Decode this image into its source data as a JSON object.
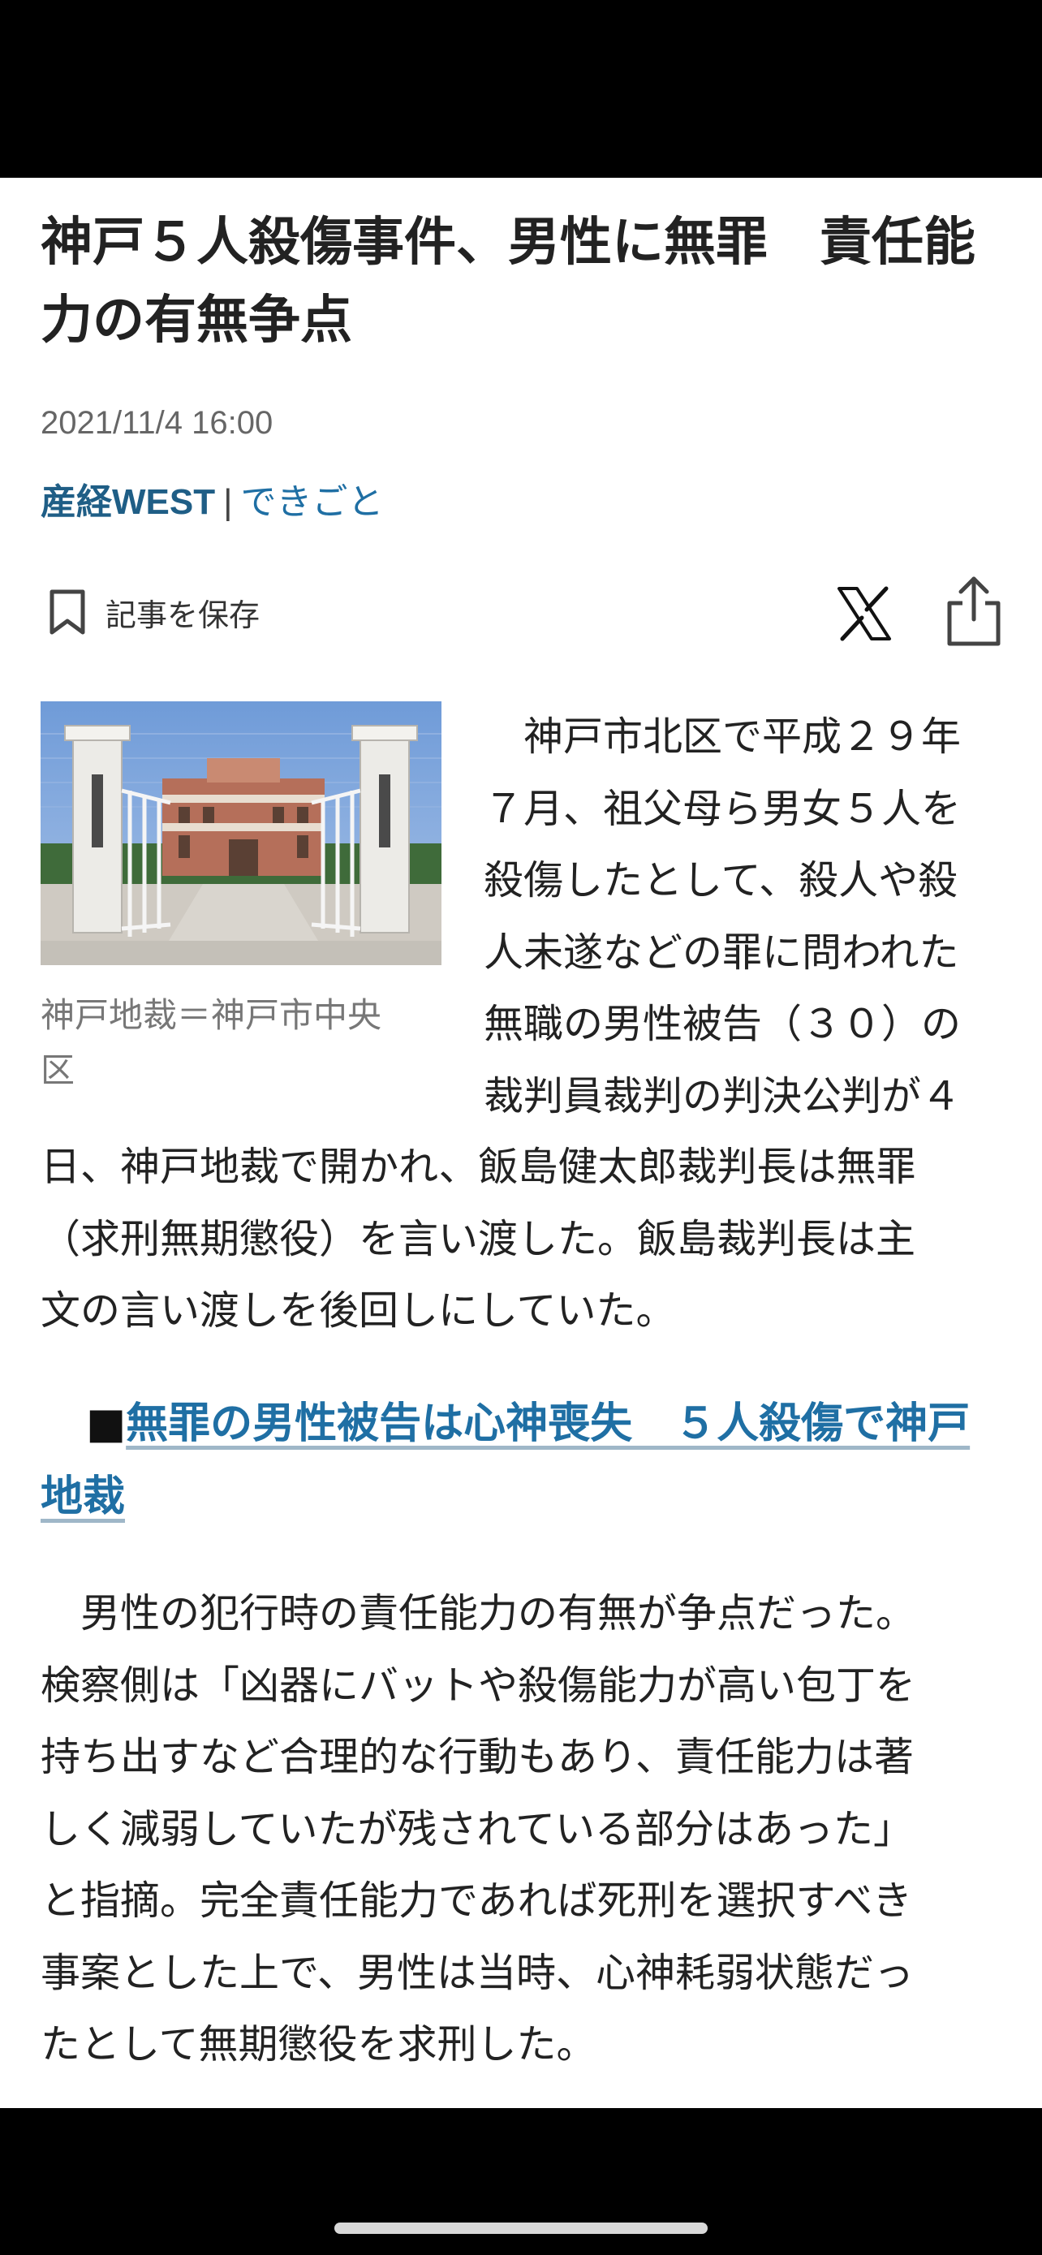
{
  "article": {
    "headline": "神戸５人殺傷事件、男性に無罪　責任能\n力の有無争点",
    "timestamp": "2021/11/4 16:00",
    "source": "産経WEST",
    "separator": "|",
    "category": "できごと"
  },
  "toolbar": {
    "save_label": "記事を保存",
    "save_icon": "bookmark-icon",
    "x_icon": "x-logo-icon",
    "share_icon": "share-icon"
  },
  "photo": {
    "caption": "神戸地裁＝神戸市中央\n区"
  },
  "body": {
    "p1_right": "　神戸市北区で平成２９年\n７月、祖父母ら男女５人を\n殺傷したとして、殺人や殺\n人未遂などの罪に問われた\n無職の男性被告（３０）の\n裁判員裁判の判決公判が４",
    "p1_full": "日、神戸地裁で開かれ、飯島健太郎裁判長は無罪\n（求刑無期懲役）を言い渡した。飯島裁判長は主\n文の言い渡しを後回しにしていた。",
    "subhead_bullet": "■",
    "subhead_link": "無罪の男性被告は心神喪失　５人殺傷で神戸\n地裁",
    "p2": "　男性の犯行時の責任能力の有無が争点だった。\n検察側は「凶器にバットや殺傷能力が高い包丁を\n持ち出すなど合理的な行動もあり、責任能力は著\nしく減弱していたが残されている部分はあった」\nと指摘。完全責任能力であれば死刑を選択すべき\n事案とした上で、男性は当時、心神耗弱状態だっ\nたとして無期懲役を求刑した。"
  },
  "colors": {
    "link": "#1f6fa4",
    "source": "#1f5e86",
    "text": "#222222",
    "muted": "#666666"
  }
}
